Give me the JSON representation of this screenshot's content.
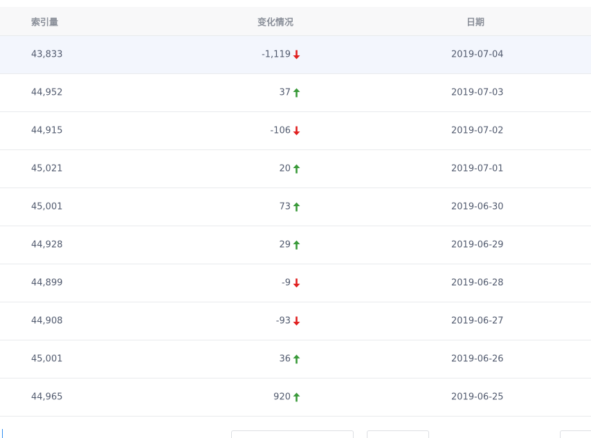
{
  "table": {
    "headers": {
      "index": "索引量",
      "change": "变化情况",
      "date": "日期"
    },
    "rows": [
      {
        "index": "43,833",
        "change": "-1,119",
        "direction": "down",
        "date": "2019-07-04"
      },
      {
        "index": "44,952",
        "change": "37",
        "direction": "up",
        "date": "2019-07-03"
      },
      {
        "index": "44,915",
        "change": "-106",
        "direction": "down",
        "date": "2019-07-02"
      },
      {
        "index": "45,021",
        "change": "20",
        "direction": "up",
        "date": "2019-07-01"
      },
      {
        "index": "45,001",
        "change": "73",
        "direction": "up",
        "date": "2019-06-30"
      },
      {
        "index": "44,928",
        "change": "29",
        "direction": "up",
        "date": "2019-06-29"
      },
      {
        "index": "44,899",
        "change": "-9",
        "direction": "down",
        "date": "2019-06-28"
      },
      {
        "index": "44,908",
        "change": "-93",
        "direction": "down",
        "date": "2019-06-27"
      },
      {
        "index": "45,001",
        "change": "36",
        "direction": "up",
        "date": "2019-06-26"
      },
      {
        "index": "44,965",
        "change": "920",
        "direction": "up",
        "date": "2019-06-25"
      }
    ]
  },
  "icons": {
    "up": "arrow-up-icon",
    "down": "arrow-down-icon"
  },
  "colors": {
    "up": "#3a9a3a",
    "down": "#e02020",
    "header_bg": "#f8f8f9",
    "highlight_bg": "#f3f6fd"
  }
}
